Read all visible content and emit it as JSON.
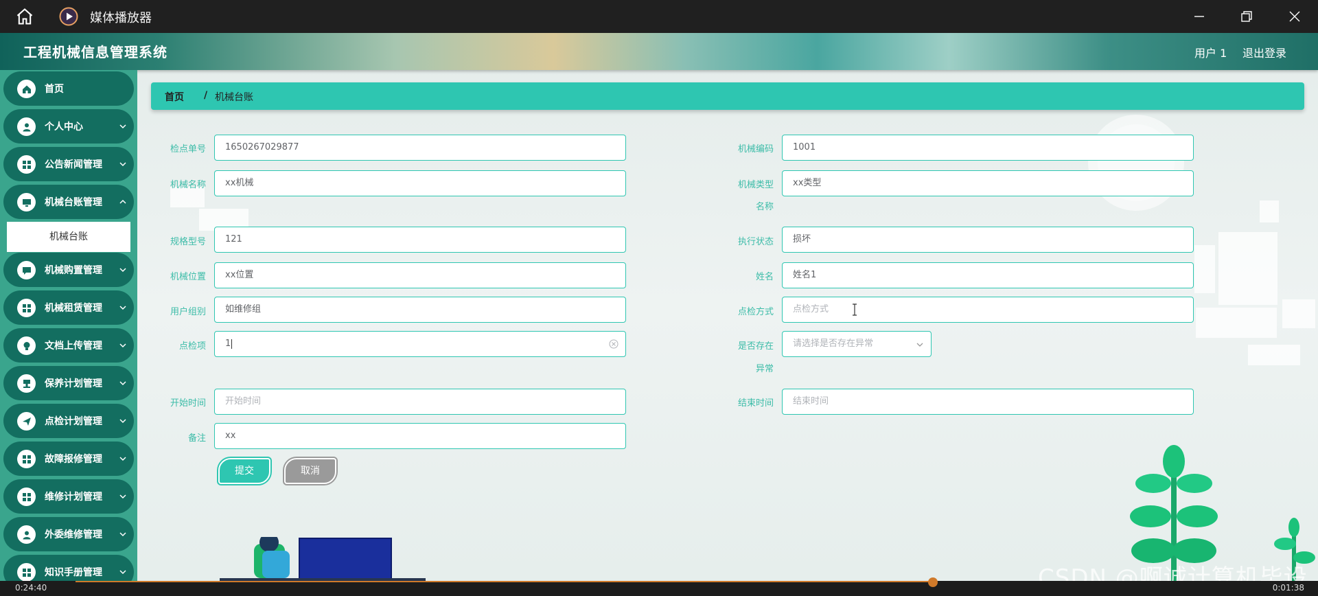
{
  "player": {
    "title": "媒体播放器",
    "time_elapsed": "0:24:40",
    "time_remaining": "0:01:38"
  },
  "header": {
    "app_title": "工程机械信息管理系统",
    "user": "用户 1",
    "logout": "退出登录"
  },
  "sidebar": {
    "items": [
      {
        "label": "首页",
        "icon": "home-icon"
      },
      {
        "label": "个人中心",
        "icon": "person-icon"
      },
      {
        "label": "公告新闻管理",
        "icon": "grid-icon"
      },
      {
        "label": "机械台账管理",
        "icon": "monitor-icon"
      },
      {
        "label": "机械购置管理",
        "icon": "chat-icon"
      },
      {
        "label": "机械租赁管理",
        "icon": "grid-icon"
      },
      {
        "label": "文档上传管理",
        "icon": "bulb-icon"
      },
      {
        "label": "保养计划管理",
        "icon": "stamp-icon"
      },
      {
        "label": "点检计划管理",
        "icon": "send-icon"
      },
      {
        "label": "故障报修管理",
        "icon": "grid-icon"
      },
      {
        "label": "维修计划管理",
        "icon": "grid-icon"
      },
      {
        "label": "外委维修管理",
        "icon": "person-icon"
      },
      {
        "label": "知识手册管理",
        "icon": "grid-icon"
      }
    ],
    "submenu": {
      "label": "机械台账"
    }
  },
  "breadcrumb": {
    "home": "首页",
    "separator": "/",
    "current": "机械台账"
  },
  "form": {
    "inspection_no": {
      "label": "检点单号",
      "value": "1650267029877"
    },
    "machine_code": {
      "label": "机械编码",
      "value": "1001"
    },
    "machine_name": {
      "label": "机械名称",
      "value": "xx机械"
    },
    "machine_type": {
      "label_line1": "机械类型",
      "label_line2": "名称",
      "value": "xx类型"
    },
    "spec_model": {
      "label": "规格型号",
      "value": "121"
    },
    "exec_status": {
      "label": "执行状态",
      "value": "损坏"
    },
    "location": {
      "label": "机械位置",
      "value": "xx位置"
    },
    "name": {
      "label": "姓名",
      "value": "姓名1"
    },
    "user_group": {
      "label": "用户组别",
      "value": "如维修组"
    },
    "inspect_method": {
      "label": "点检方式",
      "placeholder": "点检方式"
    },
    "inspect_item": {
      "label": "点检项",
      "value": "1"
    },
    "has_abnormal": {
      "label_line1": "是否存在",
      "label_line2": "异常",
      "placeholder": "请选择是否存在异常"
    },
    "start_time": {
      "label": "开始时间",
      "placeholder": "开始时间"
    },
    "end_time": {
      "label": "结束时间",
      "placeholder": "结束时间"
    },
    "remark": {
      "label": "备注",
      "value": "xx"
    },
    "submit": "提交",
    "cancel": "取消"
  },
  "watermark": "CSDN @啊诚计算机毕设",
  "colors": {
    "primary": "#2ec6b1",
    "sidebar_item": "#136e60",
    "sidebar_bg": "#3aa58d"
  }
}
